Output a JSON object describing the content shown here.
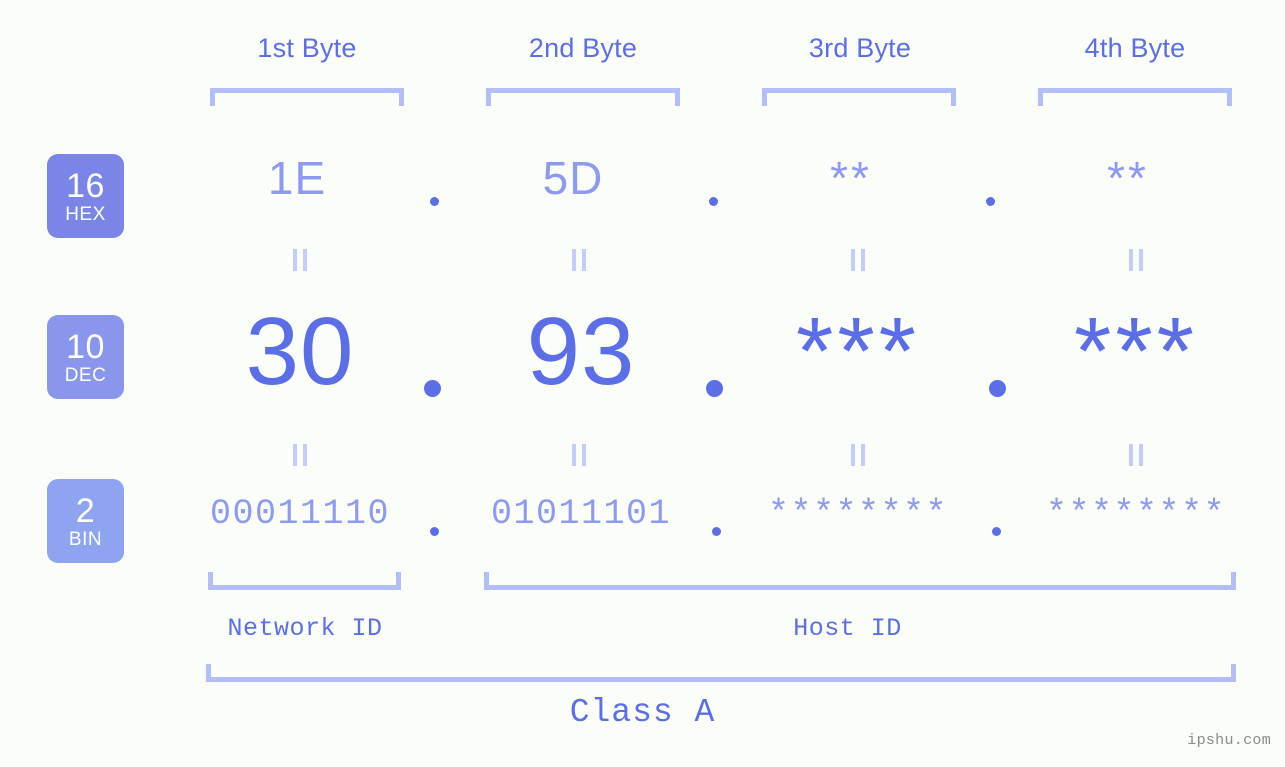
{
  "watermark": "ipshu.com",
  "colors": {
    "background": "#fbfdf9",
    "primary_blue": "#5b6ee8",
    "light_blue": "#8e99f0",
    "bracket": "#b3bdf7",
    "eq_mark": "#c4ccf9",
    "badge_hex": "#7b85e8",
    "badge_dec": "#8a95ec",
    "badge_bin": "#8fa4f0",
    "watermark_gray": "#8a8a8a"
  },
  "byte_headers": [
    {
      "label": "1st Byte"
    },
    {
      "label": "2nd Byte"
    },
    {
      "label": "3rd Byte"
    },
    {
      "label": "4th Byte"
    }
  ],
  "bases": [
    {
      "number": "16",
      "name": "HEX"
    },
    {
      "number": "10",
      "name": "DEC"
    },
    {
      "number": "2",
      "name": "BIN"
    }
  ],
  "rows": {
    "hex": {
      "values": [
        "1E",
        "5D",
        "**",
        "**"
      ],
      "separators": [
        ".",
        ".",
        "."
      ]
    },
    "dec": {
      "values": [
        "30",
        "93",
        "***",
        "***"
      ],
      "separators": [
        ".",
        ".",
        "."
      ]
    },
    "bin": {
      "values": [
        "00011110",
        "01011101",
        "********",
        "********"
      ],
      "separators": [
        ".",
        ".",
        "."
      ]
    }
  },
  "equality_marks": {
    "symbol": "=",
    "rows": 2,
    "columns": 4
  },
  "segments": {
    "network_id": "Network ID",
    "host_id": "Host ID",
    "class": "Class A"
  }
}
